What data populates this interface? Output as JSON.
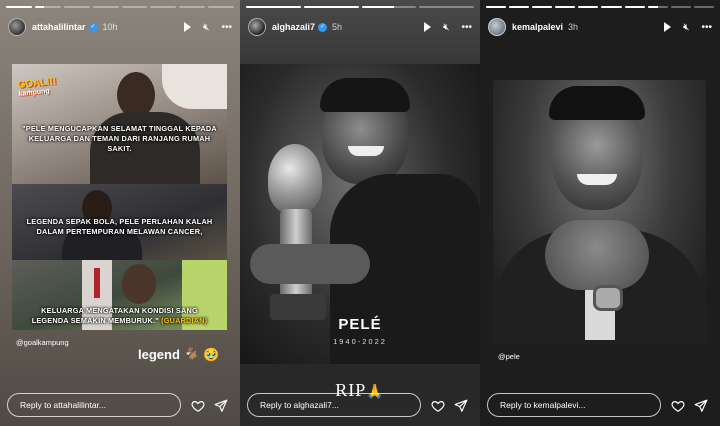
{
  "stories": [
    {
      "username": "attahalilintar",
      "verified": true,
      "time": "10h",
      "progress": [
        1.0,
        0.35,
        0.0,
        0.0,
        0.0,
        0.0,
        0.0,
        0.0
      ],
      "logo": {
        "title": "GOAL!!!",
        "sub": "kampung"
      },
      "captions": [
        "\"PELE MENGUCAPKAN SELAMAT TINGGAL KEPADA KELUARGA DAN TEMAN DARI RANJANG RUMAH SAKIT.",
        "LEGENDA SEPAK BOLA, PELE PERLAHAN KALAH DALAM PERTEMPURAN MELAWAN CANCER,",
        "KELUARGA MENGATAKAN KONDISI SANG LEGENDA SEMAKIN MEMBURUK.\""
      ],
      "caption_source": "(GUARDIAN)",
      "mention": "@goalkampung",
      "text_sticker": "legend 🐐 🥹",
      "reply_placeholder": "Reply to attahalilintar..."
    },
    {
      "username": "alghazali7",
      "verified": true,
      "time": "5h",
      "progress": [
        1.0,
        1.0,
        0.6,
        0.0
      ],
      "title": "PELÉ",
      "dates": "1940-2022",
      "rip": "RIP",
      "rip_emoji": "🙏",
      "reply_placeholder": "Reply to alghazali7..."
    },
    {
      "username": "kemalpalevi",
      "verified": false,
      "time": "3h",
      "progress": [
        1.0,
        1.0,
        1.0,
        1.0,
        1.0,
        1.0,
        1.0,
        0.5,
        0.0,
        0.0
      ],
      "mention": "@pele",
      "reply_placeholder": "Reply to kemalpalevi..."
    }
  ],
  "icons": [
    "play-icon",
    "mute-icon",
    "more-icon",
    "heart-icon",
    "send-icon"
  ],
  "colors": {
    "verified": "#3897f0",
    "caption_accent": "#f2c417"
  }
}
